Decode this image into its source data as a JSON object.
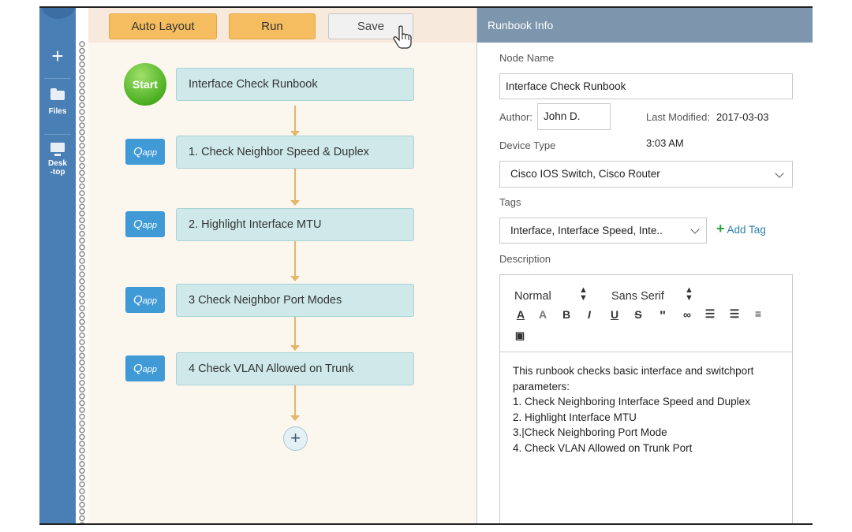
{
  "nav": {
    "items": [
      {
        "icon": "plus-icon",
        "label": ""
      },
      {
        "icon": "folder-icon",
        "label": "Files"
      },
      {
        "icon": "monitor-icon",
        "label": "Desk\n-top"
      }
    ]
  },
  "toolbar": {
    "auto_layout_label": "Auto Layout",
    "run_label": "Run",
    "save_label": "Save"
  },
  "flow": {
    "start_label": "Start",
    "badge_text": "Q",
    "badge_sub": "app",
    "nodes": [
      "Interface Check Runbook",
      "1. Check Neighbor Speed & Duplex",
      "2. Highlight Interface MTU",
      "3 Check Neighbor Port Modes",
      "4 Check VLAN Allowed on Trunk"
    ],
    "add_label": "+"
  },
  "panel": {
    "title": "Runbook Info",
    "node_name_label": "Node Name",
    "node_name_value": "Interface Check Runbook",
    "author_label": "Author:",
    "author_value": "John D.",
    "last_modified_label": "Last Modified:",
    "last_modified_date": "2017-03-03",
    "last_modified_time": "3:03 AM",
    "device_type_label": "Device Type",
    "device_type_value": "Cisco IOS Switch, Cisco Router",
    "tags_label": "Tags",
    "tags_value": "Interface, Interface Speed, Inte..",
    "add_tag_label": "Add Tag",
    "description_label": "Description",
    "editor": {
      "format_value": "Normal",
      "font_value": "Sans Serif"
    },
    "description_lines": [
      "This runbook checks basic interface and switchport",
      "parameters:",
      "1. Check Neighboring Interface Speed and Duplex",
      "2. Highlight Interface MTU",
      "3.|Check Neighboring Port Mode",
      "4. Check VLAN Allowed on Trunk Port"
    ]
  },
  "colors": {
    "nav": "#4a7fb5",
    "button_orange": "#f5bd5f",
    "node_fill": "#cfe9ea",
    "flow_line": "#e6b569",
    "panel_header": "#7d96ae",
    "qapp_blue": "#3f9ad6",
    "start_green": "#4caf22",
    "add_tag_green": "#2ea043"
  }
}
